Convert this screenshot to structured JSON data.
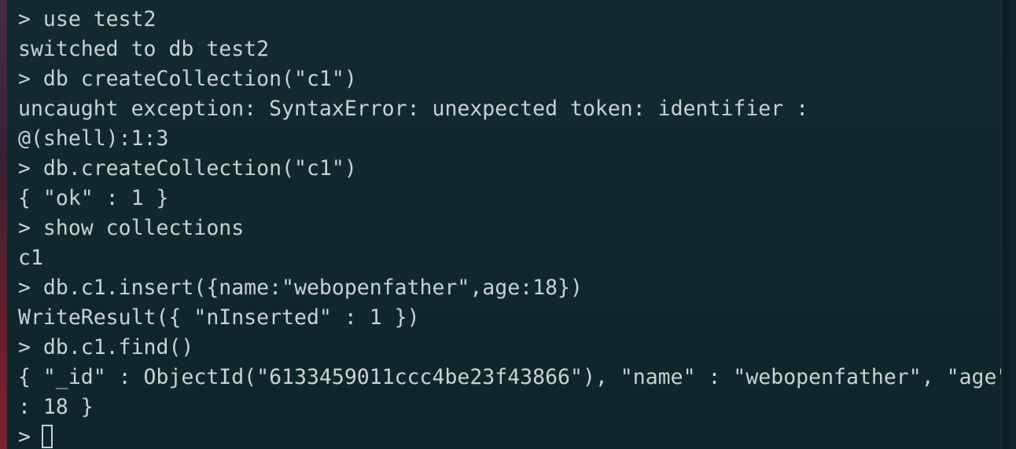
{
  "terminal": {
    "lines": [
      "> use test2",
      "switched to db test2",
      "> db createCollection(\"c1\")",
      "uncaught exception: SyntaxError: unexpected token: identifier :",
      "@(shell):1:3",
      "> db.createCollection(\"c1\")",
      "{ \"ok\" : 1 }",
      "> show collections",
      "c1",
      "> db.c1.insert({name:\"webopenfather\",age:18})",
      "WriteResult({ \"nInserted\" : 1 })",
      "> db.c1.find()",
      "{ \"_id\" : ObjectId(\"6133459011ccc4be23f43866\"), \"name\" : \"webopenfather\", \"age\"",
      ": 18 }"
    ],
    "prompt": ">"
  }
}
